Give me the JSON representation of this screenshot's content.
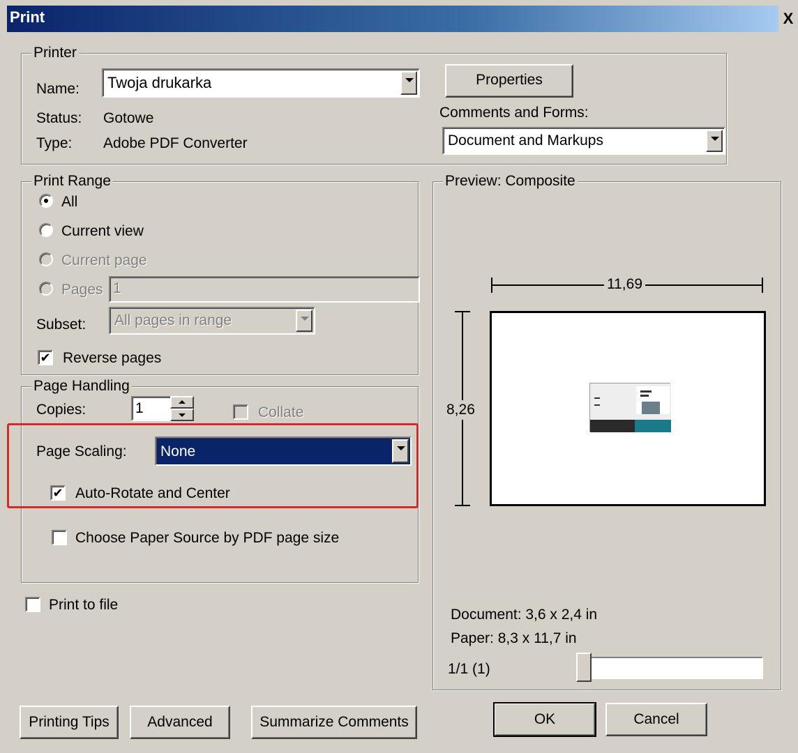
{
  "window": {
    "title": "Print",
    "close_glyph": "X"
  },
  "printer": {
    "legend": "Printer",
    "name_label": "Name:",
    "name_value": "Twoja drukarka",
    "status_label": "Status:",
    "status_value": "Gotowe",
    "type_label": "Type:",
    "type_value": "Adobe PDF Converter",
    "properties_button": "Properties",
    "comments_label": "Comments and Forms:",
    "comments_value": "Document and Markups"
  },
  "print_range": {
    "legend": "Print Range",
    "all": "All",
    "current_view": "Current view",
    "current_page": "Current page",
    "pages": "Pages",
    "pages_value": "1",
    "subset_label": "Subset:",
    "subset_value": "All pages in range",
    "reverse_pages": "Reverse pages",
    "selected": "all",
    "reverse_checked": true
  },
  "page_handling": {
    "legend": "Page Handling",
    "copies_label": "Copies:",
    "copies_value": "1",
    "collate": "Collate",
    "scaling_label": "Page Scaling:",
    "scaling_value": "None",
    "auto_rotate": "Auto-Rotate and Center",
    "auto_rotate_checked": true,
    "paper_source": "Choose Paper Source by PDF page size",
    "paper_source_checked": false
  },
  "print_to_file": {
    "label": "Print to file",
    "checked": false
  },
  "preview": {
    "legend": "Preview: Composite",
    "width_value": "11,69",
    "height_value": "8,26",
    "document_size": "Document: 3,6 x 2,4 in",
    "paper_size": "Paper: 8,3 x 11,7 in",
    "page_indicator": "1/1 (1)"
  },
  "buttons": {
    "printing_tips": "Printing Tips",
    "advanced": "Advanced",
    "summarize": "Summarize Comments",
    "ok": "OK",
    "cancel": "Cancel"
  },
  "colors": {
    "title_bar": "#0a246a",
    "highlight": "#d12b2b",
    "face": "#d4d0c8"
  }
}
